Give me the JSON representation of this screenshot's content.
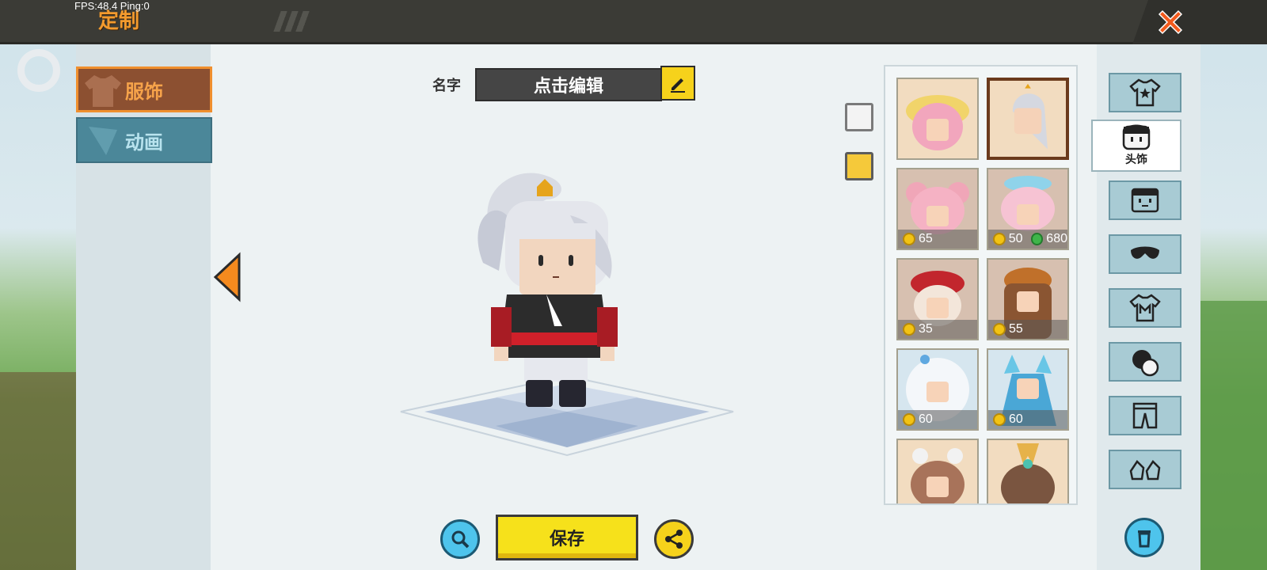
{
  "hud": {
    "fps_text": "FPS:48.4  Ping:0"
  },
  "header": {
    "title": "定制"
  },
  "tabs": [
    {
      "label": "服饰",
      "active": true
    },
    {
      "label": "动画",
      "active": false
    }
  ],
  "name_field": {
    "label": "名字",
    "value": "点击编辑"
  },
  "palette": {
    "white": "#f3f3f3",
    "yellow": "#f5c93a"
  },
  "items": [
    {
      "id": "hair-pink-hat",
      "price_coin": null,
      "price_gem": null,
      "selected": false
    },
    {
      "id": "hair-silver-ponytail",
      "price_coin": null,
      "price_gem": null,
      "selected": true
    },
    {
      "id": "hair-pink-buns",
      "price_coin": "65",
      "price_gem": null,
      "selected": false
    },
    {
      "id": "hair-pink-braids",
      "price_coin": "50",
      "price_gem": "680",
      "selected": false
    },
    {
      "id": "hair-red-hat",
      "price_coin": "35",
      "price_gem": null,
      "selected": false
    },
    {
      "id": "hair-brown-long",
      "price_coin": "55",
      "price_gem": null,
      "selected": false
    },
    {
      "id": "hair-white-curly",
      "price_coin": "60",
      "price_gem": null,
      "selected": false
    },
    {
      "id": "hair-blue-horns",
      "price_coin": "60",
      "price_gem": null,
      "selected": false
    },
    {
      "id": "hair-bear-ears",
      "price_coin": null,
      "price_gem": null,
      "selected": false
    },
    {
      "id": "hair-golden-crown",
      "price_coin": null,
      "price_gem": null,
      "selected": false
    }
  ],
  "categories": [
    {
      "id": "suit",
      "icon": "shirt-star-icon",
      "label": ""
    },
    {
      "id": "headwear",
      "icon": "face-hair-icon",
      "label": "头饰"
    },
    {
      "id": "face",
      "icon": "face-icon",
      "label": ""
    },
    {
      "id": "mask",
      "icon": "mask-icon",
      "label": ""
    },
    {
      "id": "top",
      "icon": "tshirt-m-icon",
      "label": ""
    },
    {
      "id": "gloves",
      "icon": "gloves-icon",
      "label": ""
    },
    {
      "id": "pants",
      "icon": "pants-icon",
      "label": ""
    },
    {
      "id": "shoes",
      "icon": "shoes-icon",
      "label": ""
    }
  ],
  "footer": {
    "save_label": "保存"
  }
}
